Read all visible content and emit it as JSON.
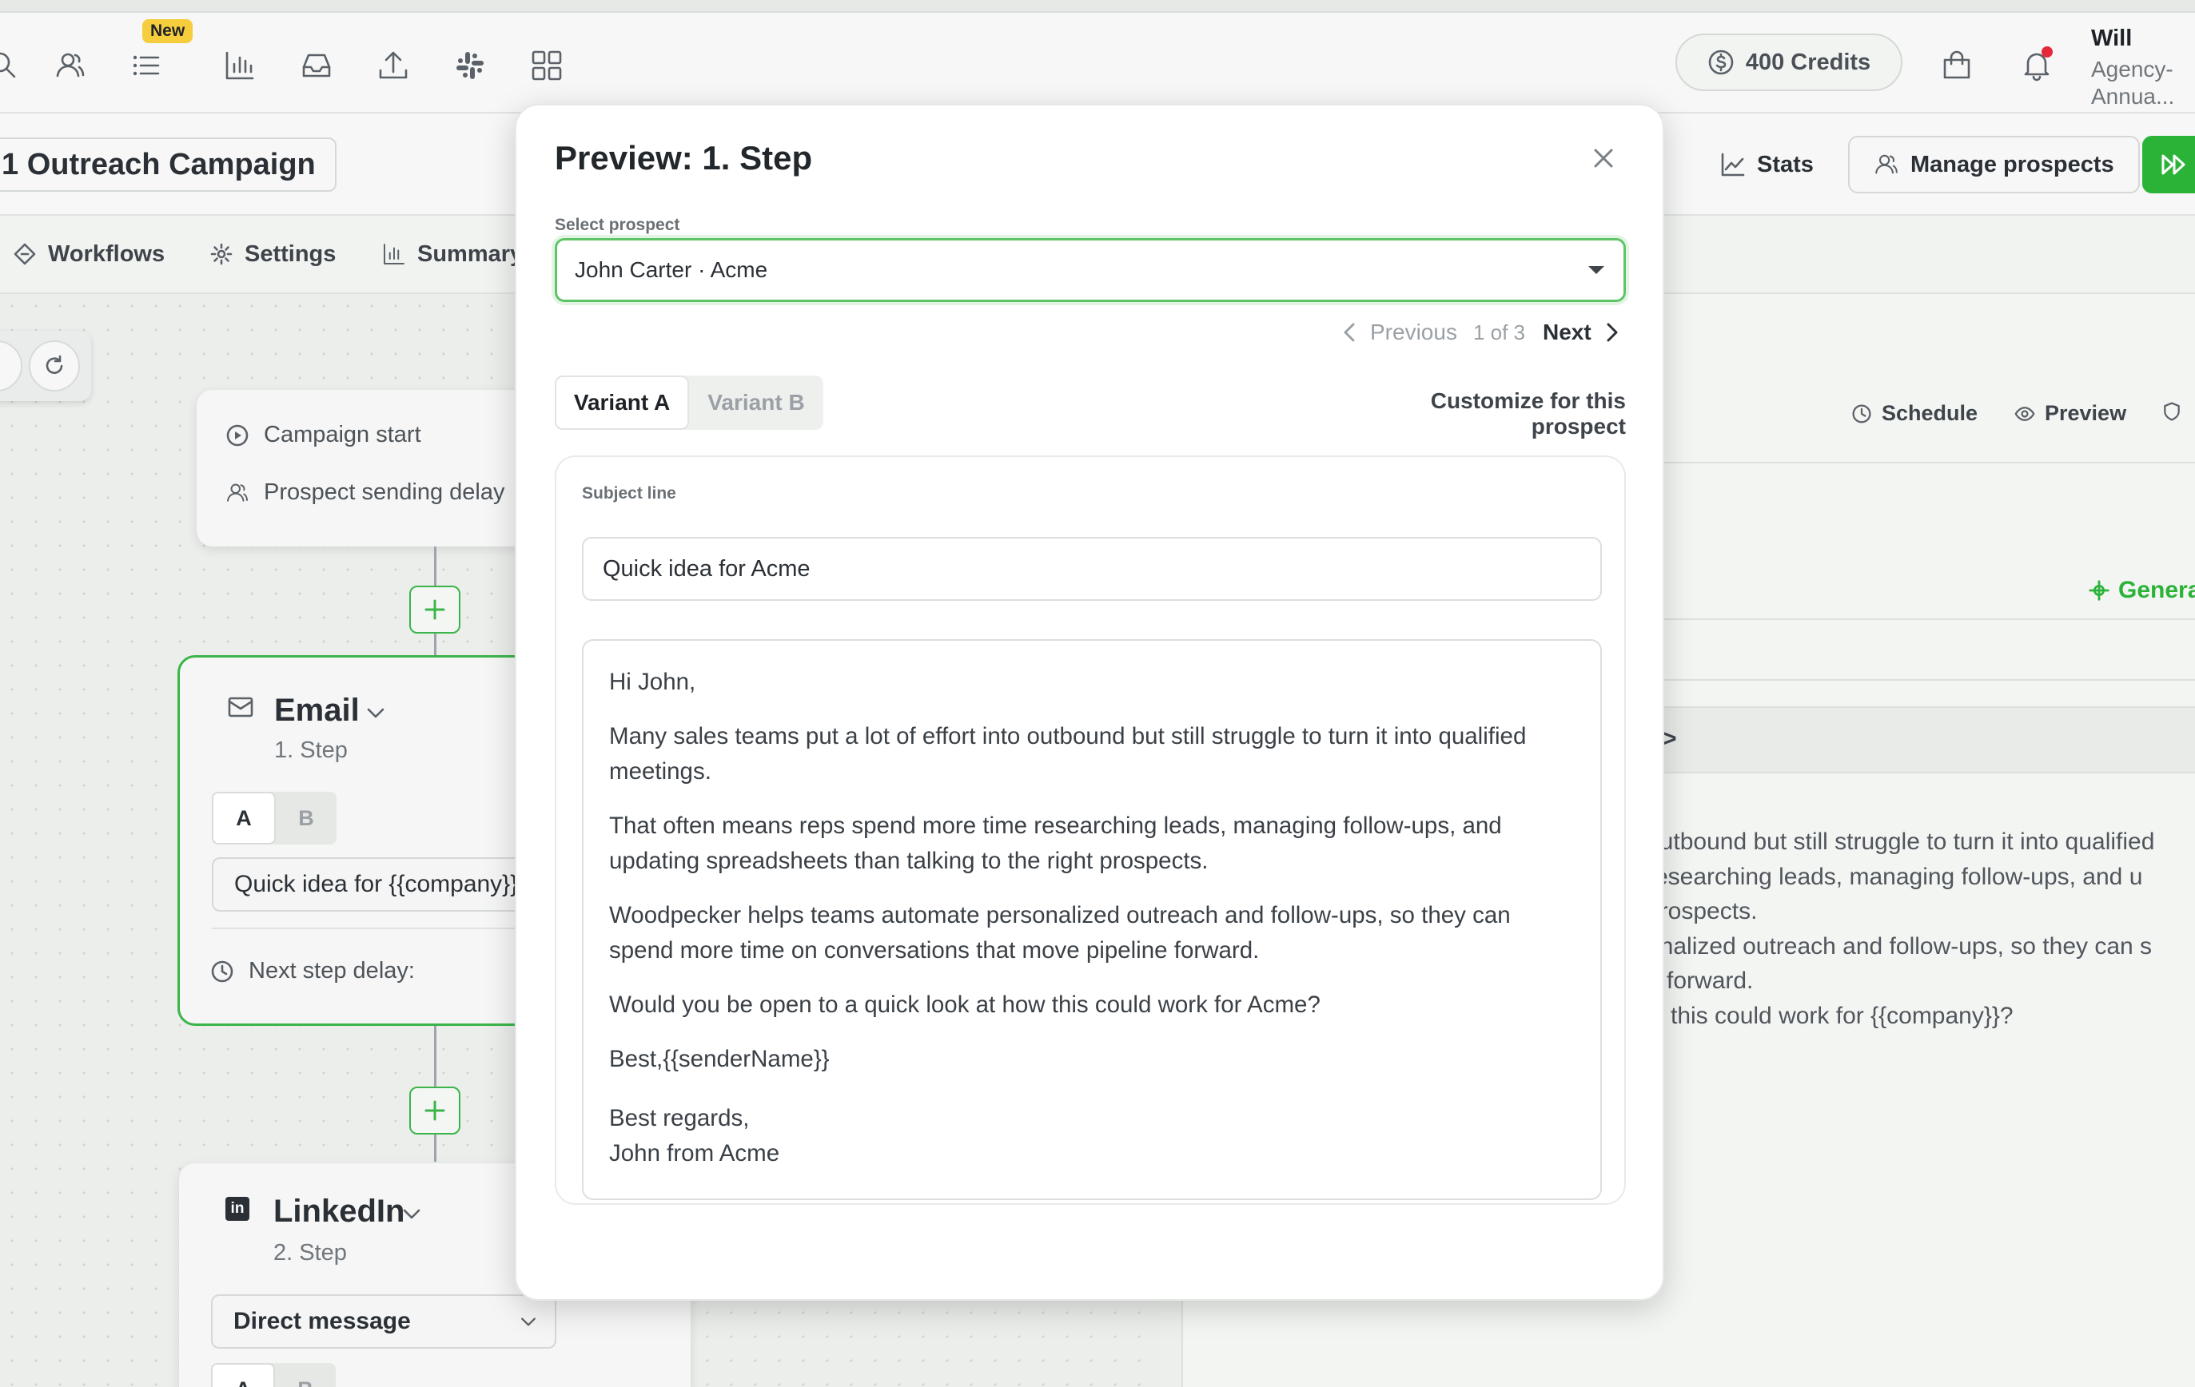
{
  "topbar": {
    "new_badge": "New",
    "credits": "400 Credits",
    "user_name": "Will",
    "user_plan": "Agency-Annua..."
  },
  "campaign": {
    "title": "1 Outreach Campaign",
    "stats": "Stats",
    "manage_prospects": "Manage prospects"
  },
  "tabs": [
    "Workflows",
    "Settings",
    "Summary"
  ],
  "canvas": {
    "start_items": [
      "Campaign start",
      "Prospect sending delay"
    ],
    "email_step": {
      "name": "Email",
      "number": "1. Step",
      "variant_a": "A",
      "variant_b": "B",
      "subject": "Quick idea for {{company}}",
      "delay": "Next step delay:"
    },
    "linkedin_step": {
      "name": "LinkedIn",
      "number": "2. Step",
      "action": "Direct message",
      "variant_a": "A",
      "variant_b": "B"
    }
  },
  "right_panel": {
    "schedule": "Schedule",
    "preview": "Preview",
    "generate": "Generate",
    "band_chevron": ">",
    "lines": [
      "outbound but still struggle to turn it into qualified",
      "researching leads, managing follow-ups, and u",
      "prospects.",
      "onalized outreach and follow-ups, so they can s",
      "e forward.",
      "w this could work for {{company}}?"
    ]
  },
  "modal": {
    "title": "Preview: 1. Step",
    "select_label": "Select prospect",
    "selected_prospect": "John Carter · Acme",
    "previous": "Previous",
    "page_info": "1 of 3",
    "next": "Next",
    "variant_a": "Variant A",
    "variant_b": "Variant B",
    "customize": "Customize for this prospect",
    "subject_label": "Subject line",
    "subject_value": "Quick idea for Acme",
    "body": [
      "Hi John,",
      "Many sales teams put a lot of effort into outbound but still struggle to turn it into qualified meetings.",
      "That often means reps spend more time researching leads, managing follow-ups, and updating spreadsheets than talking to the right prospects.",
      "Woodpecker helps teams automate personalized outreach and follow-ups, so they can spend more time on conversations that move pipeline forward.",
      "Would you be open to a quick look at how this could work for Acme?",
      "Best,{{senderName}}"
    ],
    "signature": [
      "Best regards,",
      "John from Acme"
    ]
  },
  "colors": {
    "accent_green": "#2bb338",
    "notification_red": "#e5293b",
    "badge_yellow": "#f6cd3d"
  }
}
